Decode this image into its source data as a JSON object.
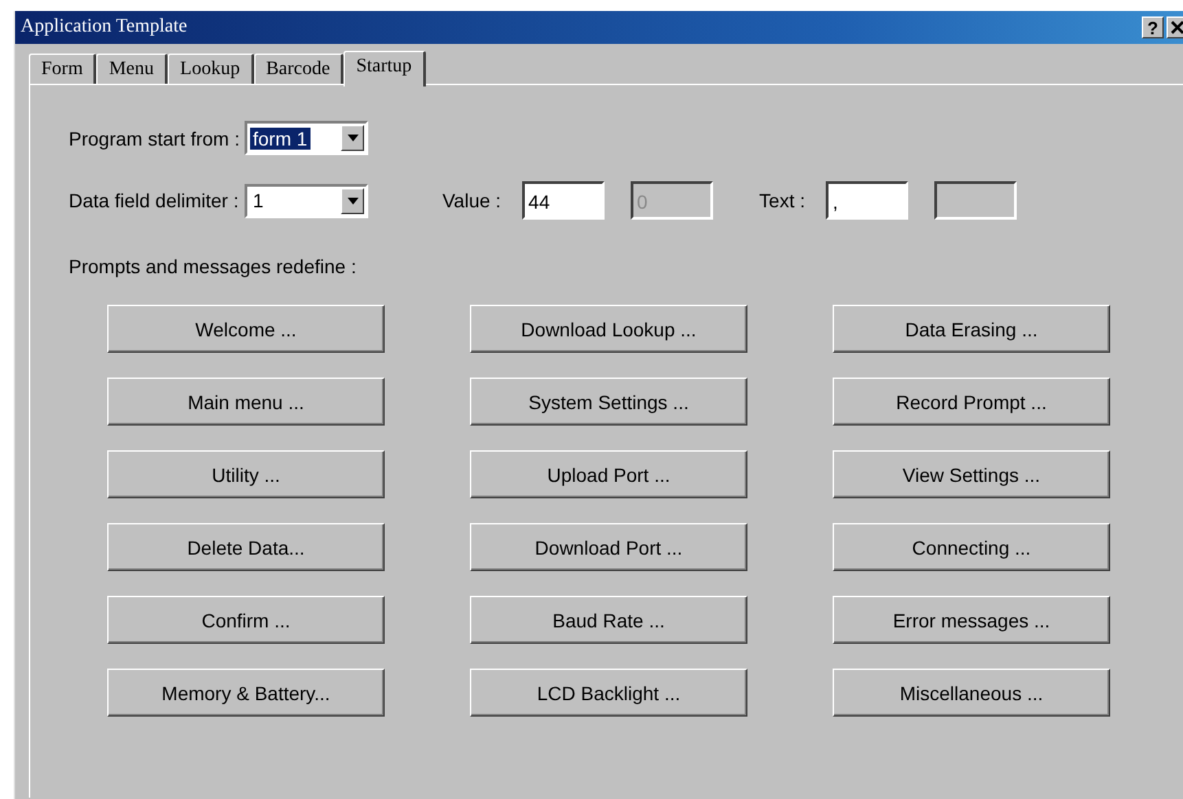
{
  "window": {
    "title": "Application Template",
    "help_button": "?"
  },
  "tabs": [
    {
      "label": "Form",
      "selected": false
    },
    {
      "label": "Menu",
      "selected": false
    },
    {
      "label": "Lookup",
      "selected": false
    },
    {
      "label": "Barcode",
      "selected": false
    },
    {
      "label": "Startup",
      "selected": true
    }
  ],
  "program_start": {
    "label": "Program start from :",
    "value": "form 1",
    "highlighted": true
  },
  "delimiter": {
    "label": "Data field delimiter :",
    "value": "1",
    "highlighted": false
  },
  "value": {
    "label": "Value :",
    "fields": [
      {
        "value": "44",
        "disabled": false
      },
      {
        "value": "0",
        "disabled": true
      }
    ]
  },
  "text": {
    "label": "Text :",
    "fields": [
      {
        "value": ",",
        "disabled": false
      },
      {
        "disabled": true
      }
    ]
  },
  "prompts_label": "Prompts and messages redefine :",
  "buttons": [
    "Welcome ...",
    "Download Lookup ...",
    "Data Erasing ...",
    "Main menu ...",
    "System Settings ...",
    "Record Prompt ...",
    "Utility ...",
    "Upload Port ...",
    "View Settings ...",
    "Delete Data...",
    "Download Port ...",
    "Connecting ...",
    "Confirm ...",
    "Baud Rate ...",
    "Error messages ...",
    "Memory & Battery...",
    "LCD Backlight ...",
    "Miscellaneous ..."
  ]
}
